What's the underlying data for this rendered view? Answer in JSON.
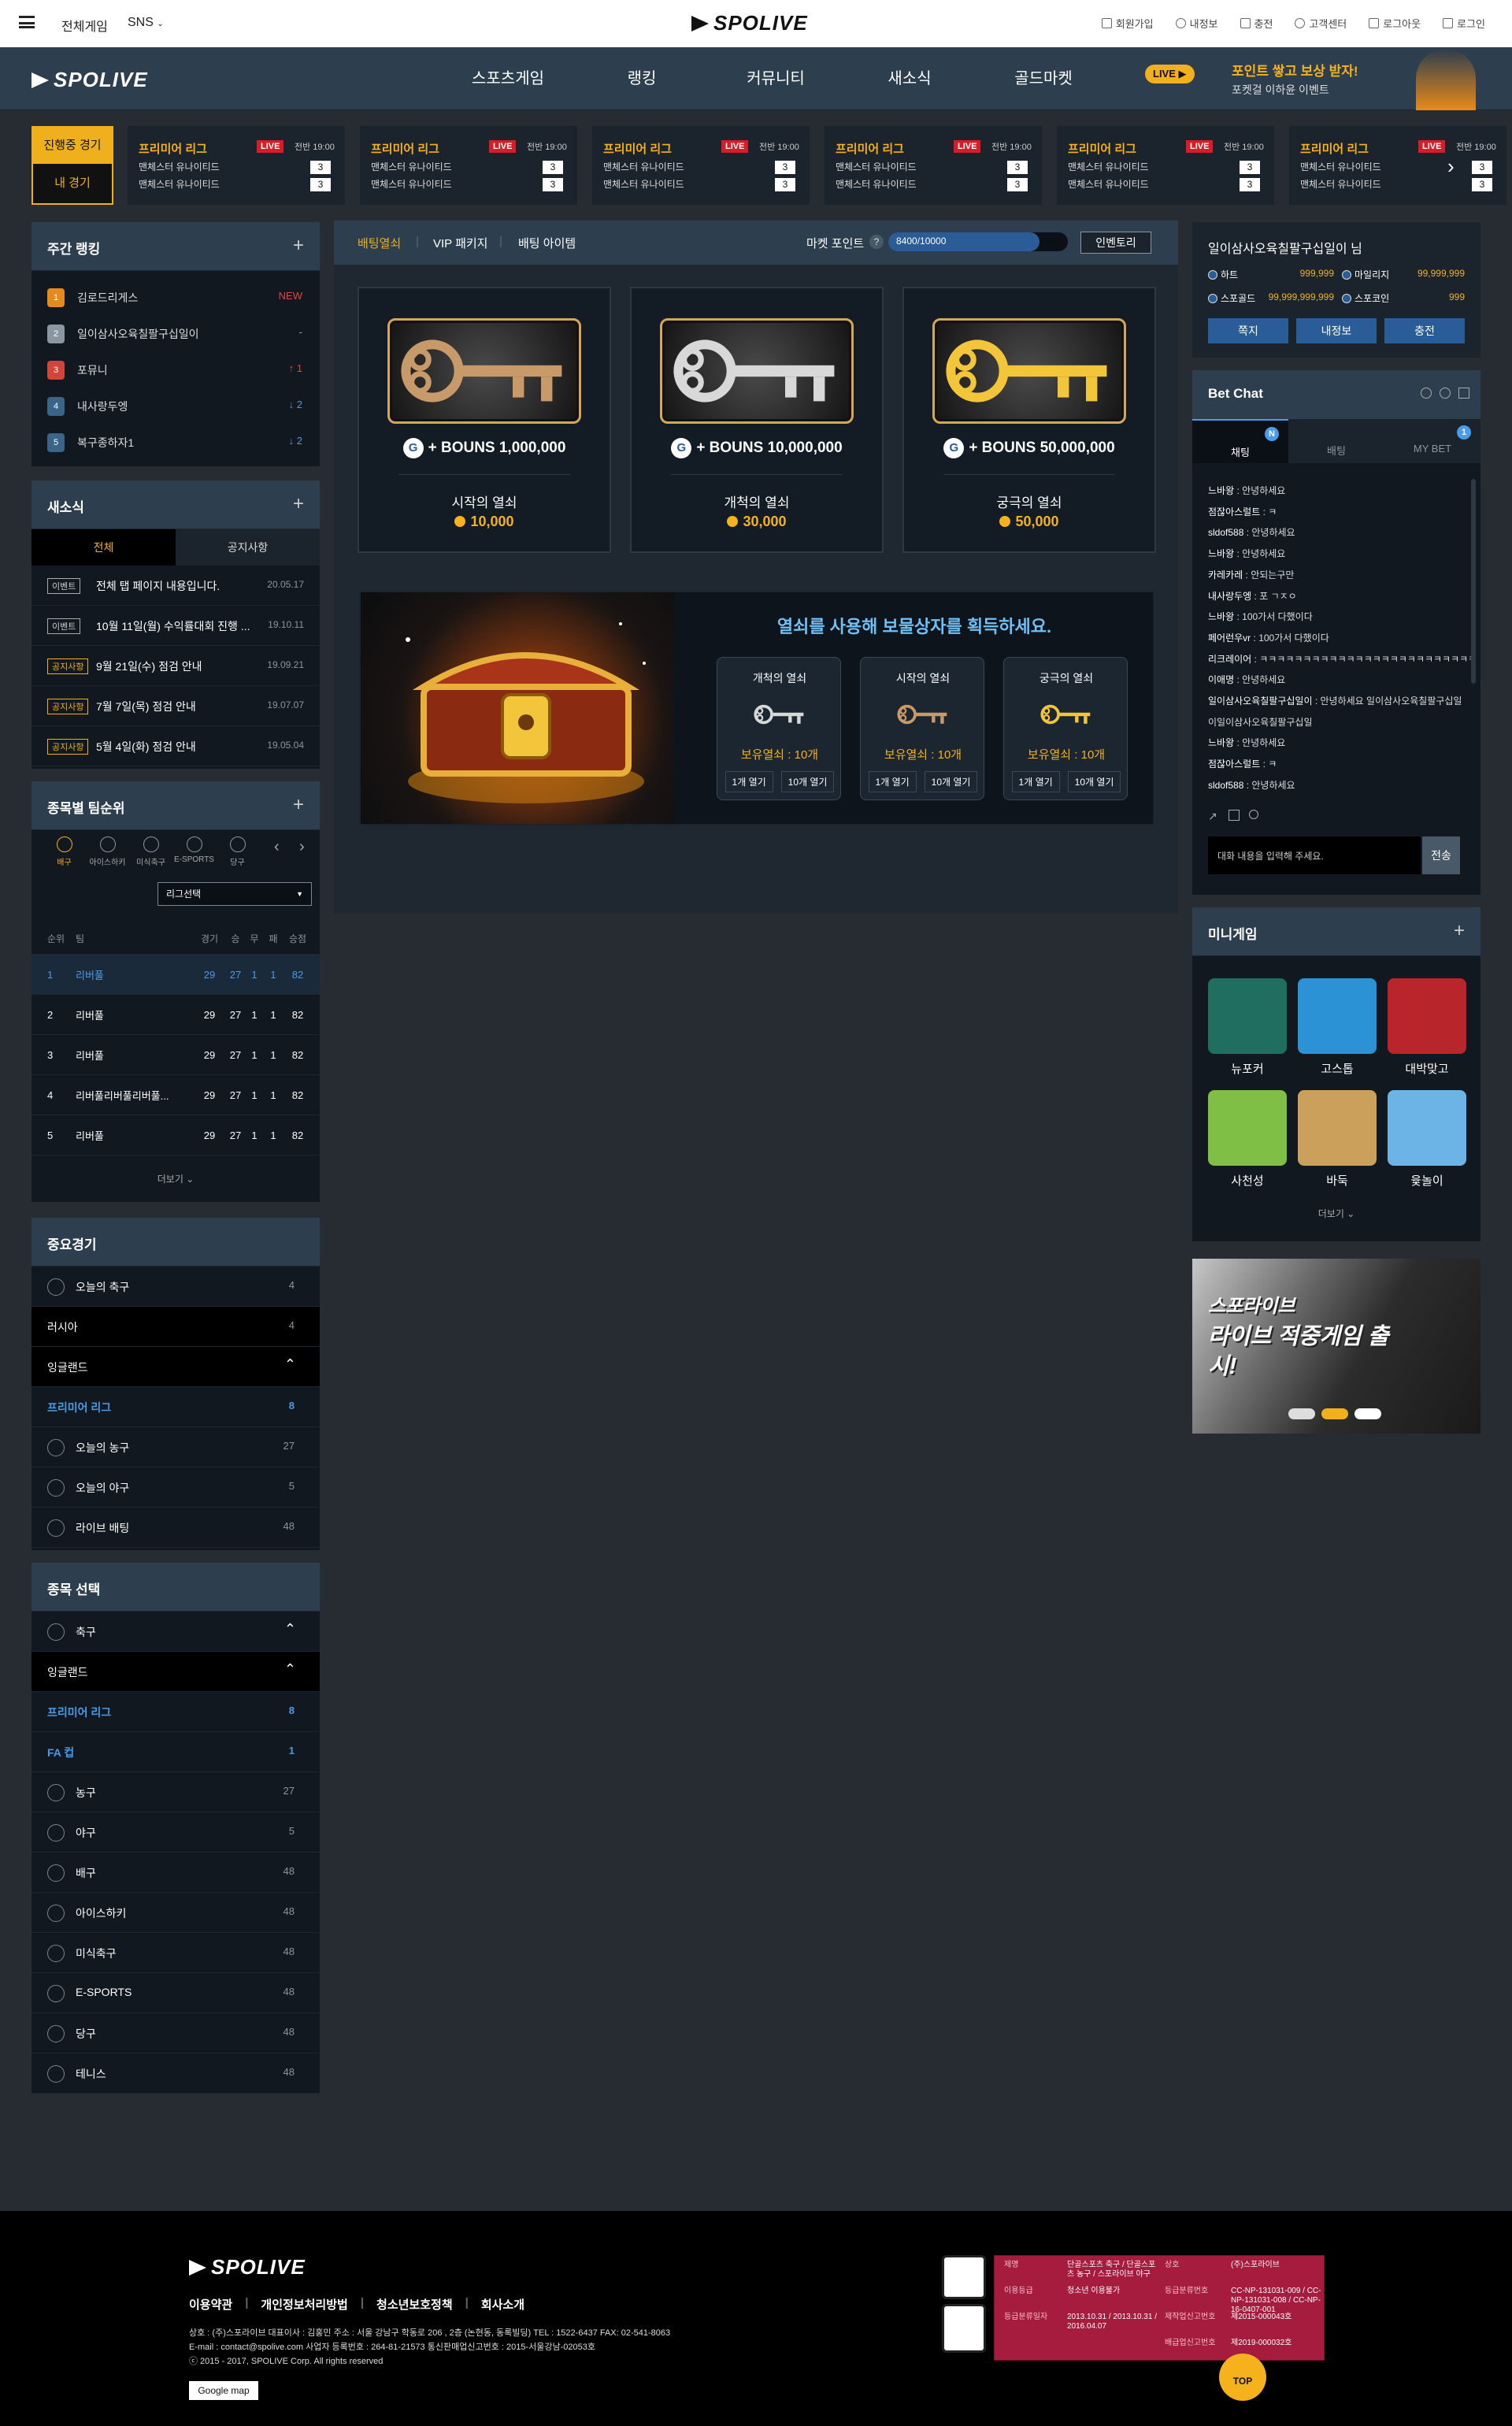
{
  "topbar": {
    "menu_label": "전체게임",
    "sns_label": "SNS",
    "logo": "SPOLIVE",
    "links": [
      "회원가입",
      "내정보",
      "충전",
      "고객센터",
      "로그아웃",
      "로그인"
    ]
  },
  "nav": {
    "logo": "SPOLIVE",
    "menu": [
      "스포츠게임",
      "랭킹",
      "커뮤니티",
      "새소식",
      "골드마켓"
    ],
    "promo_badge": "LIVE",
    "promo_title": "포인트 쌓고 보상 받자!",
    "promo_sub": "포켓걸 이하윤 이벤트"
  },
  "live_tabs": {
    "live": "진행중 경기",
    "mine": "내 경기"
  },
  "matches": [
    {
      "league": "프리미어 리그",
      "live": "LIVE",
      "time": "전반 19:00",
      "team1": "맨체스터 유나이티드",
      "score1": "3",
      "team2": "맨체스터 유나이티드",
      "score2": "3"
    },
    {
      "league": "프리미어 리그",
      "live": "LIVE",
      "time": "전반 19:00",
      "team1": "맨체스터 유나이티드",
      "score1": "3",
      "team2": "맨체스터 유나이티드",
      "score2": "3"
    },
    {
      "league": "프리미어 리그",
      "live": "LIVE",
      "time": "전반 19:00",
      "team1": "맨체스터 유나이티드",
      "score1": "3",
      "team2": "맨체스터 유나이티드",
      "score2": "3"
    },
    {
      "league": "프리미어 리그",
      "live": "LIVE",
      "time": "전반 19:00",
      "team1": "맨체스터 유나이티드",
      "score1": "3",
      "team2": "맨체스터 유나이티드",
      "score2": "3"
    },
    {
      "league": "프리미어 리그",
      "live": "LIVE",
      "time": "전반 19:00",
      "team1": "맨체스터 유나이티드",
      "score1": "3",
      "team2": "맨체스터 유나이티드",
      "score2": "3"
    },
    {
      "league": "프리미어 리그",
      "live": "LIVE",
      "time": "전반 19:00",
      "team1": "맨체스터 유나이티드",
      "score1": "3",
      "team2": "맨체스터 유나이티드",
      "score2": "3"
    }
  ],
  "weekly_ranking": {
    "title": "주간 랭킹",
    "items": [
      {
        "rank": "1",
        "name": "김로드리게스",
        "change": "NEW",
        "badge_color": "#e58a1f"
      },
      {
        "rank": "2",
        "name": "일이삼사오육칠팔구십일이",
        "change": "-",
        "badge_color": "#8a96a2"
      },
      {
        "rank": "3",
        "name": "포뮤니",
        "change": "↑ 1",
        "badge_color": "#d2453a"
      },
      {
        "rank": "4",
        "name": "내사랑두엥",
        "change": "↓ 2",
        "badge_color": "#3a6488"
      },
      {
        "rank": "5",
        "name": "복구종하자1",
        "change": "↓ 2",
        "badge_color": "#3a6488"
      }
    ]
  },
  "news": {
    "title": "새소식",
    "tabs": [
      "전체",
      "공지사항"
    ],
    "items": [
      {
        "tag": "이벤트",
        "title": "전체 탭 페이지 내용입니다.",
        "date": "20.05.17"
      },
      {
        "tag": "이벤트",
        "title": "10월 11일(월) 수익률대회 진행 ...",
        "date": "19.10.11"
      },
      {
        "tag": "공지사항",
        "title": "9월 21일(수) 점검 안내",
        "date": "19.09.21"
      },
      {
        "tag": "공지사항",
        "title": "7월 7일(목) 점검 안내",
        "date": "19.07.07"
      },
      {
        "tag": "공지사항",
        "title": "5월 4일(화) 점검 안내",
        "date": "19.05.04"
      }
    ]
  },
  "team_rank": {
    "title": "종목별 팀순위",
    "sports": [
      "배구",
      "아이스하키",
      "미식축구",
      "E-SPORTS",
      "당구"
    ],
    "league_select": "리그선택",
    "headers": [
      "순위",
      "팀",
      "경기",
      "승",
      "무",
      "패",
      "승점"
    ],
    "rows": [
      {
        "rank": "1",
        "team": "리버풀",
        "games": "29",
        "w": "27",
        "d": "1",
        "l": "1",
        "pts": "82"
      },
      {
        "rank": "2",
        "team": "리버풀",
        "games": "29",
        "w": "27",
        "d": "1",
        "l": "1",
        "pts": "82"
      },
      {
        "rank": "3",
        "team": "리버풀",
        "games": "29",
        "w": "27",
        "d": "1",
        "l": "1",
        "pts": "82"
      },
      {
        "rank": "4",
        "team": "리버풀리버풀리버풀...",
        "games": "29",
        "w": "27",
        "d": "1",
        "l": "1",
        "pts": "82"
      },
      {
        "rank": "5",
        "team": "리버풀",
        "games": "29",
        "w": "27",
        "d": "1",
        "l": "1",
        "pts": "82"
      }
    ],
    "more": "더보기"
  },
  "important_games": {
    "title": "중요경기",
    "items": [
      {
        "label": "오늘의 축구",
        "count": "4"
      },
      {
        "label": "러시아",
        "count": "4"
      },
      {
        "label": "잉글랜드",
        "count": ""
      },
      {
        "label": "프리미어 리그",
        "count": "8"
      },
      {
        "label": "오늘의 농구",
        "count": "27"
      },
      {
        "label": "오늘의 야구",
        "count": "5"
      },
      {
        "label": "라이브 배팅",
        "count": "48"
      }
    ]
  },
  "sport_select": {
    "title": "종목 선택",
    "items": [
      {
        "label": "축구",
        "count": ""
      },
      {
        "label": "잉글랜드",
        "count": ""
      },
      {
        "label": "프리미어 리그",
        "count": "8"
      },
      {
        "label": "FA 컵",
        "count": "1"
      },
      {
        "label": "농구",
        "count": "27"
      },
      {
        "label": "야구",
        "count": "5"
      },
      {
        "label": "배구",
        "count": "48"
      },
      {
        "label": "아이스하키",
        "count": "48"
      },
      {
        "label": "미식축구",
        "count": "48"
      },
      {
        "label": "E-SPORTS",
        "count": "48"
      },
      {
        "label": "당구",
        "count": "48"
      },
      {
        "label": "테니스",
        "count": "48"
      }
    ]
  },
  "market": {
    "tabs": [
      "배팅열쇠",
      "VIP 패키지",
      "배팅 아이템"
    ],
    "point_label": "마켓 포인트",
    "point_value": "8400/10000",
    "point_fraction": 0.84,
    "inventory": "인벤토리",
    "keys": [
      {
        "bonus": "+ BOUNS 1,000,000",
        "name": "시작의 열쇠",
        "price": "10,000",
        "color": "#c89a6a"
      },
      {
        "bonus": "+ BOUNS 10,000,000",
        "name": "개척의 열쇠",
        "price": "30,000",
        "color": "#d8d8d8"
      },
      {
        "bonus": "+ BOUNS 50,000,000",
        "name": "궁극의 열쇠",
        "price": "50,000",
        "color": "#f2c53a"
      }
    ],
    "chest_title": "열쇠를 사용해 보물상자를 획득하세요.",
    "chest_boxes": [
      {
        "name": "개척의 열쇠",
        "held": "보유열쇠 : 10개",
        "open1": "1개 열기",
        "open10": "10개 열기",
        "color": "#d8d8d8"
      },
      {
        "name": "시작의 열쇠",
        "held": "보유열쇠 : 10개",
        "open1": "1개 열기",
        "open10": "10개 열기",
        "color": "#c89a6a"
      },
      {
        "name": "궁극의 열쇠",
        "held": "보유열쇠 : 10개",
        "open1": "1개 열기",
        "open10": "10개 열기",
        "color": "#f2c53a"
      }
    ]
  },
  "user": {
    "name": "일이삼사오육칠팔구십일이 님",
    "currencies": [
      {
        "label": "하트",
        "value": "999,999"
      },
      {
        "label": "마일리지",
        "value": "99,999,999"
      },
      {
        "label": "스포골드",
        "value": "99,999,999,999"
      },
      {
        "label": "스포코인",
        "value": "999"
      }
    ],
    "buttons": [
      "쪽지",
      "내정보",
      "충전"
    ]
  },
  "chat": {
    "title": "Bet Chat",
    "tabs": [
      {
        "label": "채팅",
        "badge": "N"
      },
      {
        "label": "배팅",
        "badge": ""
      },
      {
        "label": "MY BET",
        "badge": "1"
      }
    ],
    "messages": [
      {
        "user": "느바왕",
        "text": "안녕하세요"
      },
      {
        "user": "점잖아스럴트",
        "text": "ㅋ"
      },
      {
        "user": "sldof588",
        "text": "안녕하세요"
      },
      {
        "user": "느바왕",
        "text": "안녕하세요"
      },
      {
        "user": "카레카레",
        "text": "안되는구만"
      },
      {
        "user": "내사랑두엥",
        "text": "포 ㄱㅈㅇ"
      },
      {
        "user": "느바왕",
        "text": "100가서 다했이다"
      },
      {
        "user": "페어런우vr",
        "text": "100가서 다했이다"
      },
      {
        "user": "리크레이어",
        "text": "ㅋㅋㅋㅋㅋㅋㅋㅋㅋㅋㅋㅋㅋㅋㅋㅋㅋㅋㅋㅋㅋㅋㅋㅋㅋㅋ"
      },
      {
        "user": "이애명",
        "text": "안녕하세요"
      },
      {
        "user": "일이삼사오육칠팔구십일이",
        "text": "안녕하세요 일이삼사오육칠팔구십일"
      },
      {
        "user": "",
        "text": "이일이삼사오육칠팔구십일"
      },
      {
        "user": "느바왕",
        "text": "안녕하세요"
      },
      {
        "user": "점잖아스럴트",
        "text": "ㅋ"
      },
      {
        "user": "sldof588",
        "text": "안녕하세요"
      }
    ],
    "input_placeholder": "대화 내용을 입력해 주세요.",
    "send": "전송"
  },
  "minigame": {
    "title": "미니게임",
    "games": [
      {
        "name": "뉴포커",
        "color": "#1f6e5f"
      },
      {
        "name": "고스톱",
        "color": "#2c92d6"
      },
      {
        "name": "대박맞고",
        "color": "#b8262c"
      },
      {
        "name": "사천성",
        "color": "#7fbf46"
      },
      {
        "name": "바둑",
        "color": "#caa05a"
      },
      {
        "name": "윷놀이",
        "color": "#6db4e6"
      }
    ],
    "more": "더보기"
  },
  "banner": {
    "line1": "스포라이브",
    "line2": "라이브 적중게임 출시!"
  },
  "footer": {
    "logo": "SPOLIVE",
    "links": [
      "이용약관",
      "개인정보처리방법",
      "청소년보호정책",
      "회사소개"
    ],
    "info1": "상호 : (주)스포라이브 대표이사 : 김홍민 주소 : 서울 강남구 학동로 206 , 2층 (논현동, 동록빌딩) TEL : 1522-6437 FAX: 02-541-8063",
    "info2": "E-mail : contact@spolive.com 사업자 등록번호 : 264-81-21573 통신판매업신고번호 : 2015-서울강남-02053호",
    "info3": "ⓒ 2015 - 2017, SPOLIVE Corp. All rights reserved",
    "gmap": "Google map",
    "rating_table": {
      "r1": [
        "제명",
        "단골스포츠 축구 / 단골스포츠 농구 / 스포라이브 야구",
        "상호",
        "(주)스포라이브"
      ],
      "r2": [
        "이용등급",
        "청소년 이용불가",
        "등급분류번호",
        "CC-NP-131031-009 / CC-NP-131031-008 / CC-NP-16-0407-001"
      ],
      "r3": [
        "등급분류일자",
        "2013.10.31 / 2013.10.31 / 2016.04.07",
        "제작업신고번호",
        "제2015-000043호"
      ],
      "r4": [
        "",
        "",
        "배급업신고번호",
        "제2019-000032호"
      ]
    },
    "top": "TOP"
  }
}
